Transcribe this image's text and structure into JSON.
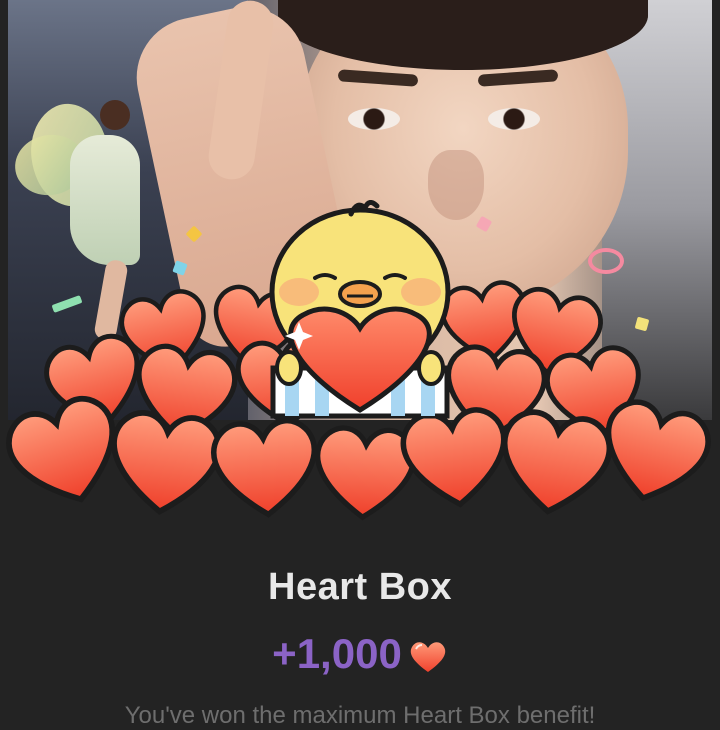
{
  "dialog": {
    "title": "Heart Box",
    "reward_amount": "+1,000",
    "message": "You've won the maximum Heart Box benefit!"
  },
  "icons": {
    "reward_icon": "heart-icon",
    "mascot": "chick-mascot",
    "decoration": "fairy-sticker"
  },
  "colors": {
    "background": "#232323",
    "title": "#e8e8e8",
    "reward": "#8b63c6",
    "heart": "#f4604a",
    "message": "#6e6e6e"
  }
}
